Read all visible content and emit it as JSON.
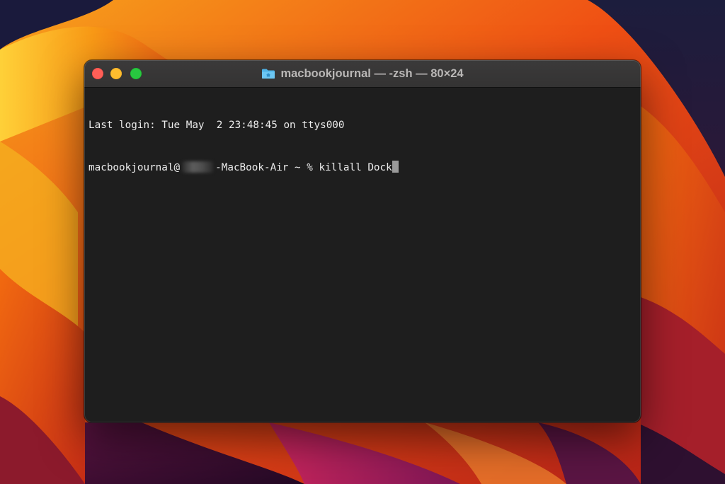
{
  "window": {
    "title": "macbookjournal — -zsh — 80×24",
    "folder_icon": "home-folder-icon"
  },
  "terminal": {
    "last_login": "Last login: Tue May  2 23:48:45 on ttys000",
    "prompt_user": "macbookjournal@",
    "prompt_host_suffix": "-MacBook-Air ~ % ",
    "command": "killall Dock"
  },
  "colors": {
    "close": "#ff5f57",
    "minimize": "#febc2e",
    "maximize": "#28c840",
    "terminal_bg": "#1e1e1e",
    "text": "#ececec"
  }
}
